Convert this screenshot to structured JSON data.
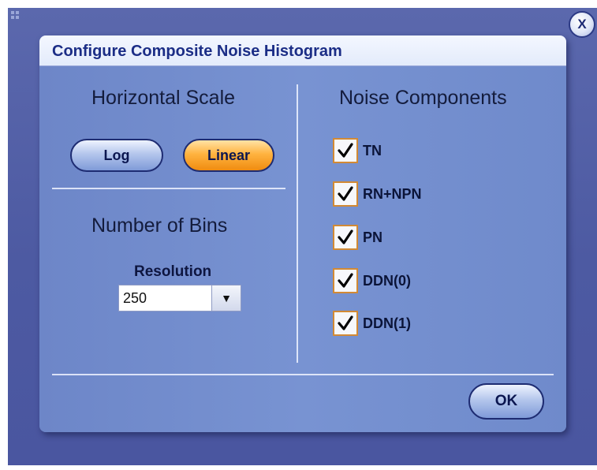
{
  "window": {
    "close_label": "X"
  },
  "dialog": {
    "title": "Configure Composite Noise Histogram",
    "horizontal_scale": {
      "heading": "Horizontal Scale",
      "log_label": "Log",
      "linear_label": "Linear",
      "selected": "Linear"
    },
    "bins": {
      "heading": "Number of Bins",
      "resolution_label": "Resolution",
      "resolution_value": "250"
    },
    "noise_components": {
      "heading": "Noise Components",
      "items": [
        {
          "label": "TN",
          "checked": true
        },
        {
          "label": "RN+NPN",
          "checked": true
        },
        {
          "label": "PN",
          "checked": true
        },
        {
          "label": "DDN(0)",
          "checked": true
        },
        {
          "label": "DDN(1)",
          "checked": true
        }
      ]
    },
    "ok_label": "OK"
  },
  "colors": {
    "background": "#4d5aa2",
    "panel": "#7590d0",
    "title_text": "#1b2d86",
    "accent_orange": "#ffb340",
    "checkbox_border": "#d28a35"
  },
  "icons": {
    "close": "close-icon",
    "dropdown": "dropdown-arrow-icon",
    "check": "checkmark-icon",
    "grip": "grip-icon"
  }
}
